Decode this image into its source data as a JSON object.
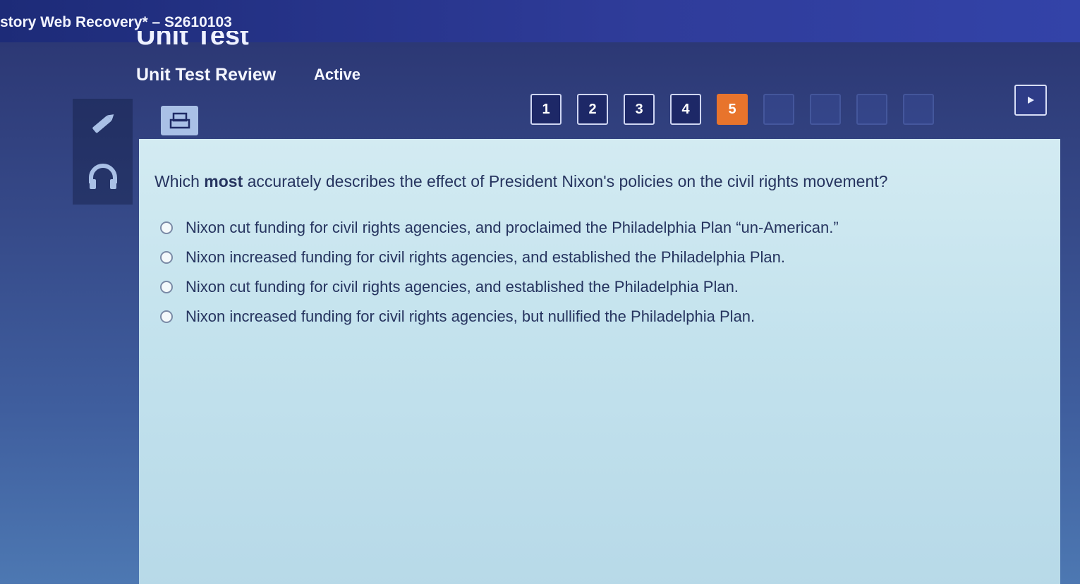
{
  "window": {
    "title": "story Web Recovery* – S2610103"
  },
  "header": {
    "unit_heading": "Unit Test",
    "review_title": "Unit Test Review",
    "status": "Active"
  },
  "sidebar": {
    "tools": [
      {
        "name": "pencil-icon"
      },
      {
        "name": "headphones-icon"
      }
    ]
  },
  "toolbar": {
    "print_icon": "calculator-icon"
  },
  "pager": {
    "pages": [
      "1",
      "2",
      "3",
      "4",
      "5"
    ],
    "current": "5",
    "accent_color": "#e8742c",
    "next_icon": "play-icon"
  },
  "question": {
    "prefix": "Which ",
    "emphasis": "most",
    "suffix": " accurately describes the effect of President Nixon's policies on the civil rights movement?",
    "answers": [
      "Nixon cut funding for civil rights agencies, and proclaimed the Philadelphia Plan “un-American.”",
      "Nixon increased funding for civil rights agencies, and established the Philadelphia Plan.",
      "Nixon cut funding for civil rights agencies, and established the Philadelphia Plan.",
      "Nixon increased funding for civil rights agencies, but nullified the Philadelphia Plan."
    ]
  }
}
